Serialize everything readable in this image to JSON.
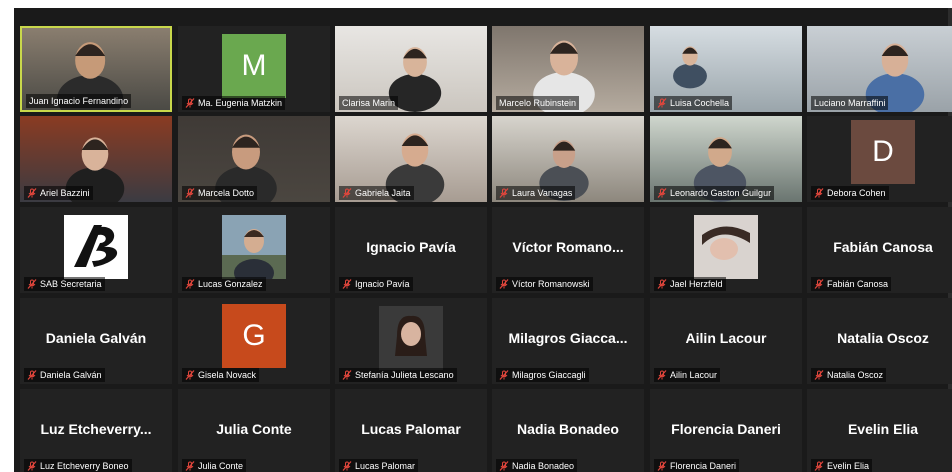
{
  "meeting": {
    "participants": [
      {
        "display_name": "Juan Ignacio Fernandino",
        "muted": false
      },
      {
        "display_name": "Ma. Eugenia Matzkin",
        "muted": true,
        "initial": "M",
        "avatar_color": "#6aa84f"
      },
      {
        "display_name": "Clarisa Marin",
        "muted": false
      },
      {
        "display_name": "Marcelo Rubinstein",
        "muted": false
      },
      {
        "display_name": "Luisa Cochella",
        "muted": true
      },
      {
        "display_name": "Luciano Marraffini",
        "muted": false
      },
      {
        "display_name": "Ariel Bazzini",
        "muted": true
      },
      {
        "display_name": "Marcela Dotto",
        "muted": true
      },
      {
        "display_name": "Gabriela Jaita",
        "muted": true
      },
      {
        "display_name": "Laura Vanagas",
        "muted": true
      },
      {
        "display_name": "Leonardo Gaston Guilgur",
        "muted": true
      },
      {
        "display_name": "Debora Cohen",
        "muted": true,
        "initial": "D",
        "avatar_color": "#6b4a3f"
      },
      {
        "display_name": "SAB Secretaria",
        "muted": true
      },
      {
        "display_name": "Lucas Gonzalez",
        "muted": true
      },
      {
        "display_name": "Ignacio Pavía",
        "muted": true,
        "center_name": "Ignacio Pavía"
      },
      {
        "display_name": "Víctor Romanowski",
        "muted": true,
        "center_name": "Víctor Romano..."
      },
      {
        "display_name": "Jael Herzfeld",
        "muted": true
      },
      {
        "display_name": "Fabián Canosa",
        "muted": true,
        "center_name": "Fabián Canosa"
      },
      {
        "display_name": "Daniela Galván",
        "muted": true,
        "center_name": "Daniela Galván"
      },
      {
        "display_name": "Gisela Novack",
        "muted": true,
        "initial": "G",
        "avatar_color": "#c74a1c"
      },
      {
        "display_name": "Stefanía Julieta Lescano",
        "muted": true
      },
      {
        "display_name": "Milagros Giaccagli",
        "muted": true,
        "center_name": "Milagros Giacca..."
      },
      {
        "display_name": "Ailin Lacour",
        "muted": true,
        "center_name": "Ailin Lacour"
      },
      {
        "display_name": "Natalia Oscoz",
        "muted": true,
        "center_name": "Natalia Oscoz"
      },
      {
        "display_name": "Luz Etcheverry Boneo",
        "muted": true,
        "center_name": "Luz Etcheverry..."
      },
      {
        "display_name": "Julia Conte",
        "muted": true,
        "center_name": "Julia Conte"
      },
      {
        "display_name": "Lucas Palomar",
        "muted": true,
        "center_name": "Lucas Palomar"
      },
      {
        "display_name": "Nadia Bonadeo",
        "muted": true,
        "center_name": "Nadia Bonadeo"
      },
      {
        "display_name": "Florencia Daneri",
        "muted": true,
        "center_name": "Florencia Daneri"
      },
      {
        "display_name": "Evelin Elia",
        "muted": true,
        "center_name": "Evelin Elia"
      }
    ]
  },
  "colors": {
    "background": "#1a1a1a",
    "tile": "#222222",
    "active_speaker_border": "#c9d84b",
    "mute_icon": "#e0463c"
  }
}
